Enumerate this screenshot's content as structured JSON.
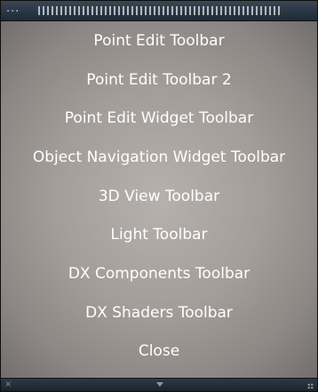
{
  "titlebar": {
    "menu_glyph": "..."
  },
  "menu": {
    "items": [
      {
        "label": "Point Edit Toolbar"
      },
      {
        "label": "Point Edit Toolbar 2"
      },
      {
        "label": "Point Edit Widget Toolbar"
      },
      {
        "label": "Object Navigation Widget Toolbar"
      },
      {
        "label": "3D View Toolbar"
      },
      {
        "label": "Light Toolbar"
      },
      {
        "label": "DX Components Toolbar"
      },
      {
        "label": "DX Shaders Toolbar"
      },
      {
        "label": "Close"
      }
    ]
  },
  "statusbar": {
    "close_glyph": "×",
    "close_icon": "close-icon",
    "arrow_icon": "chevron-down-icon",
    "grip_icon": "resize-grip-icon"
  },
  "colors": {
    "text": "#ffffff",
    "menu_center": "#b7b1ad",
    "menu_edge": "#6f6b69",
    "titlebar": "#2c3745"
  }
}
